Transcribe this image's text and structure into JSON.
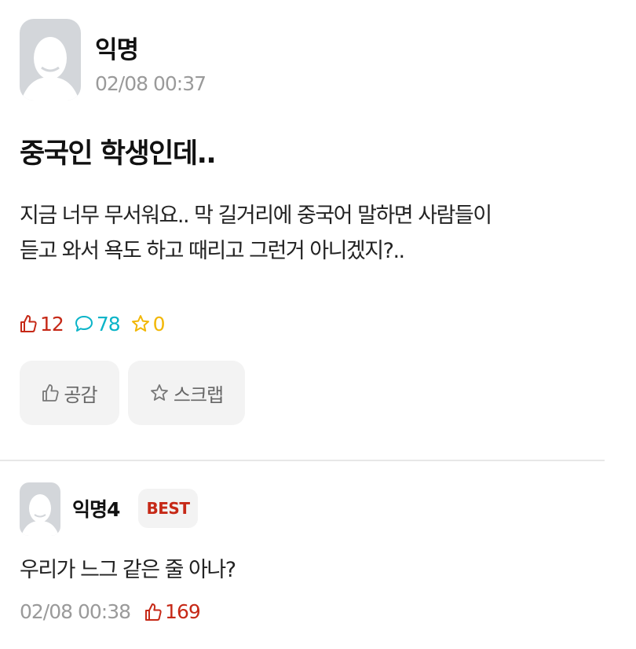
{
  "post": {
    "author": "익명",
    "time": "02/08 00:37",
    "title": "중국인 학생인데..",
    "body_line1": "지금 너무 무서워요.. 막 길거리에 중국어 말하면 사람들이",
    "body_line2": "듣고 와서 욕도 하고 때리고 그런거 아니겠지?..",
    "stats": {
      "likes": "12",
      "comments": "78",
      "scraps": "0"
    },
    "actions": {
      "like_label": "공감",
      "scrap_label": "스크랩"
    }
  },
  "comment": {
    "author": "익명4",
    "badge": "BEST",
    "text": "우리가 느그 같은 줄 아나?",
    "time": "02/08 00:38",
    "likes": "169"
  },
  "colors": {
    "like": "#c62917",
    "comment": "#0bb4c8",
    "scrap": "#f2b705",
    "avatar": "#d3d6da",
    "button_bg": "#f3f3f3"
  },
  "icons": {
    "avatar": "user-silhouette-icon",
    "like": "thumbs-up-icon",
    "comment": "speech-bubble-icon",
    "scrap": "star-icon"
  }
}
